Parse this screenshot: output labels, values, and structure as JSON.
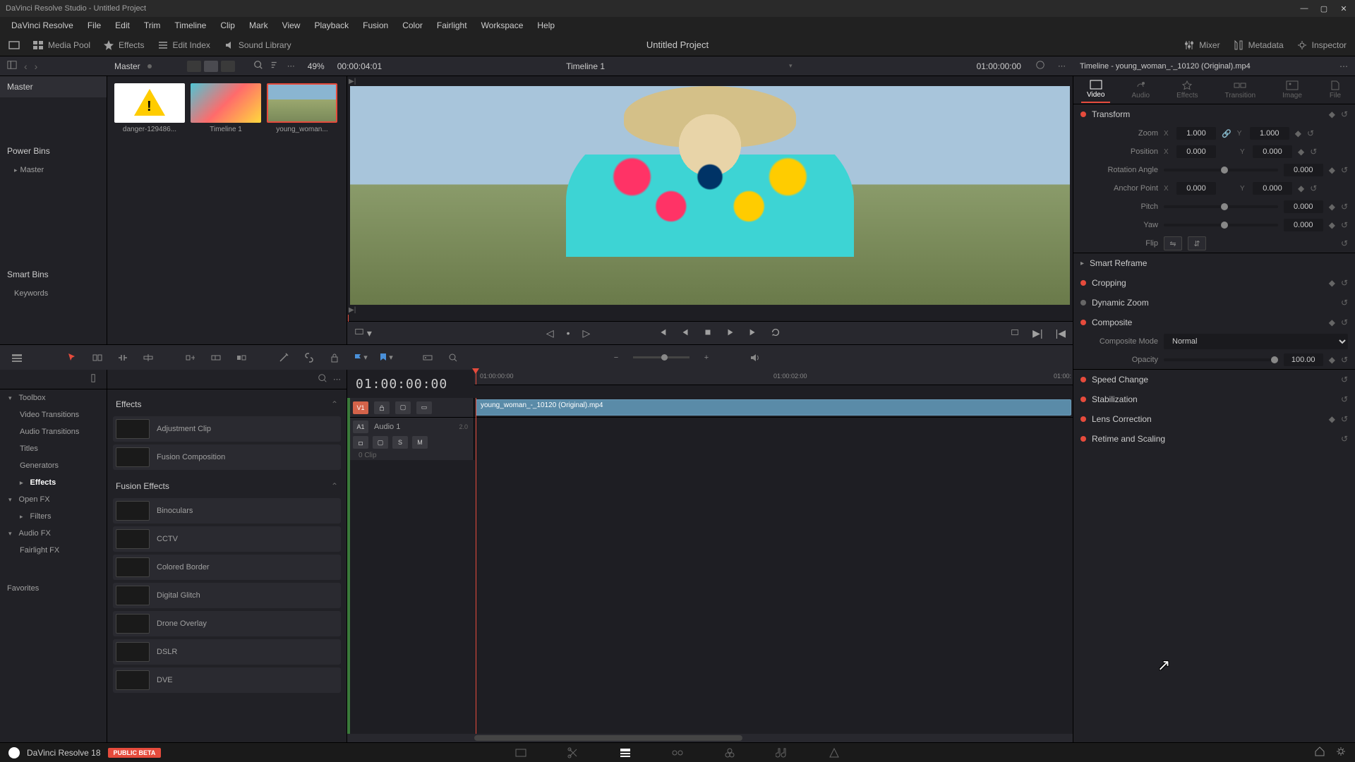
{
  "titlebar": {
    "title": "DaVinci Resolve Studio - Untitled Project"
  },
  "menubar": [
    "DaVinci Resolve",
    "File",
    "Edit",
    "Trim",
    "Timeline",
    "Clip",
    "Mark",
    "View",
    "Playback",
    "Fusion",
    "Color",
    "Fairlight",
    "Workspace",
    "Help"
  ],
  "toolbar": {
    "media_pool": "Media Pool",
    "effects": "Effects",
    "edit_index": "Edit Index",
    "sound_library": "Sound Library",
    "project_title": "Untitled Project",
    "mixer": "Mixer",
    "metadata": "Metadata",
    "inspector": "Inspector"
  },
  "secbar": {
    "breadcrumb": "Master",
    "zoom": "49%",
    "source_tc": "00:00:04:01",
    "timeline_name": "Timeline 1",
    "record_tc": "01:00:00:00",
    "inspector_clip": "Timeline - young_woman_-_10120 (Original).mp4"
  },
  "left_panel": {
    "master": "Master",
    "power_bins": "Power Bins",
    "power_master": "Master",
    "smart_bins": "Smart Bins",
    "keywords": "Keywords"
  },
  "media_pool": {
    "thumbs": [
      {
        "label": "danger-129486..."
      },
      {
        "label": "Timeline 1"
      },
      {
        "label": "young_woman..."
      }
    ]
  },
  "effects_tree": {
    "toolbox": "Toolbox",
    "video_transitions": "Video Transitions",
    "audio_transitions": "Audio Transitions",
    "titles": "Titles",
    "generators": "Generators",
    "effects": "Effects",
    "open_fx": "Open FX",
    "filters": "Filters",
    "audio_fx": "Audio FX",
    "fairlight_fx": "Fairlight FX",
    "favorites": "Favorites"
  },
  "effects_list": {
    "header1": "Effects",
    "items1": [
      "Adjustment Clip",
      "Fusion Composition"
    ],
    "header2": "Fusion Effects",
    "items2": [
      "Binoculars",
      "CCTV",
      "Colored Border",
      "Digital Glitch",
      "Drone Overlay",
      "DSLR",
      "DVE"
    ]
  },
  "timeline": {
    "timecode": "01:00:00:00",
    "ruler": [
      "01:00:00:00",
      "01:00:02:00",
      "01:00:"
    ],
    "v1": "V1",
    "a1": "A1",
    "audio1": "Audio 1",
    "audio_ch": "2.0",
    "clip_name": "young_woman_-_10120 (Original).mp4",
    "clip_count": "0 Clip",
    "s": "S",
    "m": "M"
  },
  "inspector": {
    "tabs": [
      "Video",
      "Audio",
      "Effects",
      "Transition",
      "Image",
      "File"
    ],
    "transform": {
      "title": "Transform",
      "zoom_label": "Zoom",
      "zoom_x": "1.000",
      "zoom_y": "1.000",
      "position_label": "Position",
      "pos_x": "0.000",
      "pos_y": "0.000",
      "rotation_label": "Rotation Angle",
      "rotation": "0.000",
      "anchor_label": "Anchor Point",
      "anchor_x": "0.000",
      "anchor_y": "0.000",
      "pitch_label": "Pitch",
      "pitch": "0.000",
      "yaw_label": "Yaw",
      "yaw": "0.000",
      "flip_label": "Flip"
    },
    "smart_reframe": "Smart Reframe",
    "cropping": "Cropping",
    "dynamic_zoom": "Dynamic Zoom",
    "composite": {
      "title": "Composite",
      "mode_label": "Composite Mode",
      "mode": "Normal",
      "opacity_label": "Opacity",
      "opacity": "100.00"
    },
    "speed_change": "Speed Change",
    "stabilization": "Stabilization",
    "lens_correction": "Lens Correction",
    "retime_scaling": "Retime and Scaling"
  },
  "bottombar": {
    "version": "DaVinci Resolve 18",
    "badge": "PUBLIC BETA"
  },
  "axis": {
    "x": "X",
    "y": "Y"
  }
}
